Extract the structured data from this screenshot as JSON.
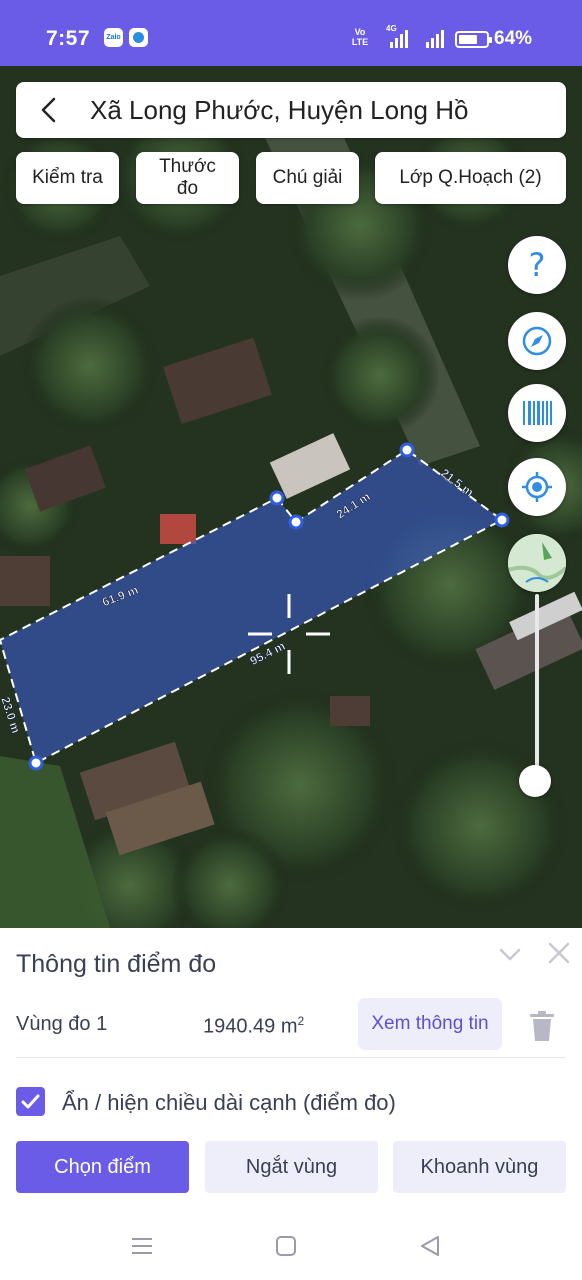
{
  "status_bar": {
    "time": "7:57",
    "app_icons": [
      "zalo-icon",
      "messenger-icon"
    ],
    "zalo_label": "Zalo",
    "volte": "Vo\nLTE",
    "network": "4G",
    "battery": "64%"
  },
  "header": {
    "location": "Xã Long Phước, Huyện Long Hồ"
  },
  "tools": {
    "check": "Kiểm tra",
    "ruler": "Thước\nđo",
    "legend": "Chú giải",
    "layer": "Lớp Q.Hoạch (2)"
  },
  "map": {
    "edge_labels": [
      "24.1 m",
      "21.5 m",
      "61.9 m",
      "95.4 m",
      "23.0 m"
    ],
    "polygon_fill": "#3a5bd0",
    "vertex_color": "#2f5fe0",
    "opacity_slider_value": 1.0
  },
  "panel": {
    "title": "Thông tin điểm đo",
    "zone_name": "Vùng đo 1",
    "zone_area_value": "1940.49 m",
    "zone_area_unit_sup": "2",
    "view_info": "Xem thông tin",
    "toggle_edges_label": "Ẩn / hiện chiều dài cạnh (điểm đo)",
    "toggle_edges_checked": true
  },
  "actions": {
    "pick_point": "Chọn điểm",
    "break_zone": "Ngắt vùng",
    "enclose_zone": "Khoanh vùng"
  },
  "colors": {
    "accent": "#6b5ce7",
    "secondary_button_bg": "#eeeefa",
    "fab_icon": "#2f8de4"
  }
}
